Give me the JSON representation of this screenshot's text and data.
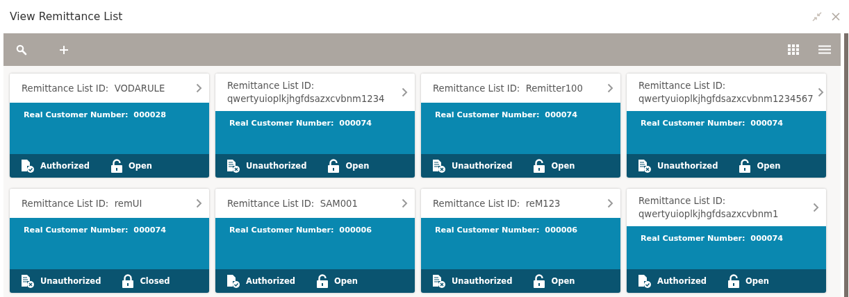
{
  "window": {
    "title": "View Remittance List"
  },
  "cards": [
    {
      "label": "Remittance List ID:",
      "value": "VODARULE",
      "customer_label": "Real Customer Number:",
      "customer_number": "000028",
      "authorized": true,
      "status": "Authorized",
      "locked": false,
      "lock_text": "Open"
    },
    {
      "label": "Remittance List ID:",
      "value": "qwertyuioplkjhgfdsazxcvbnm1234",
      "customer_label": "Real Customer Number:",
      "customer_number": "000074",
      "authorized": false,
      "status": "Unauthorized",
      "locked": false,
      "lock_text": "Open"
    },
    {
      "label": "Remittance List ID:",
      "value": "Remitter100",
      "customer_label": "Real Customer Number:",
      "customer_number": "000074",
      "authorized": false,
      "status": "Unauthorized",
      "locked": false,
      "lock_text": "Open"
    },
    {
      "label": "Remittance List ID:",
      "value": "qwertyuioplkjhgfdsazxcvbnm1234567",
      "customer_label": "Real Customer Number:",
      "customer_number": "000074",
      "authorized": false,
      "status": "Unauthorized",
      "locked": false,
      "lock_text": "Open"
    },
    {
      "label": "Remittance List ID:",
      "value": "remUI",
      "customer_label": "Real Customer Number:",
      "customer_number": "000074",
      "authorized": false,
      "status": "Unauthorized",
      "locked": true,
      "lock_text": "Closed"
    },
    {
      "label": "Remittance List ID:",
      "value": "SAM001",
      "customer_label": "Real Customer Number:",
      "customer_number": "000006",
      "authorized": true,
      "status": "Authorized",
      "locked": false,
      "lock_text": "Open"
    },
    {
      "label": "Remittance List ID:",
      "value": "reM123",
      "customer_label": "Real Customer Number:",
      "customer_number": "000006",
      "authorized": false,
      "status": "Unauthorized",
      "locked": false,
      "lock_text": "Open"
    },
    {
      "label": "Remittance List ID:",
      "value": "qwertyuioplkjhgfdsazxcvbnm1",
      "customer_label": "Real Customer Number:",
      "customer_number": "000074",
      "authorized": true,
      "status": "Authorized",
      "locked": false,
      "lock_text": "Open"
    }
  ]
}
